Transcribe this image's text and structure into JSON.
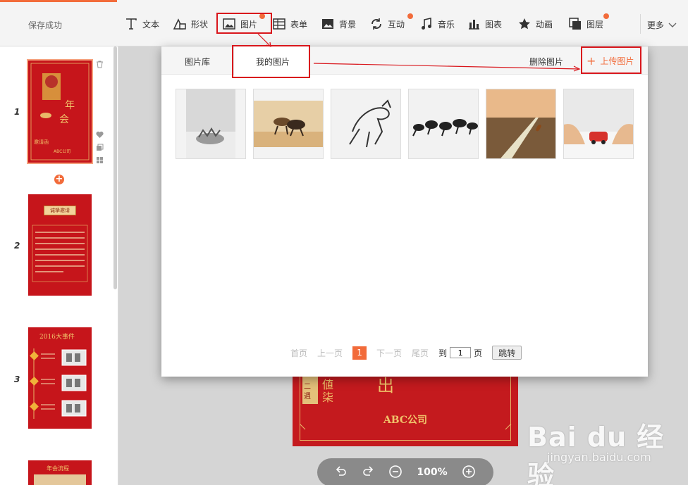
{
  "toolbar": {
    "status": "保存成功",
    "tools": [
      {
        "label": "文本",
        "icon": "text-icon"
      },
      {
        "label": "形状",
        "icon": "shape-icon"
      },
      {
        "label": "图片",
        "icon": "image-icon"
      },
      {
        "label": "表单",
        "icon": "form-icon"
      },
      {
        "label": "背景",
        "icon": "background-icon"
      },
      {
        "label": "互动",
        "icon": "interaction-icon"
      },
      {
        "label": "音乐",
        "icon": "music-icon"
      },
      {
        "label": "图表",
        "icon": "chart-icon"
      },
      {
        "label": "动画",
        "icon": "star-icon"
      },
      {
        "label": "图层",
        "icon": "layer-icon"
      }
    ],
    "more": "更多"
  },
  "sidebar": {
    "slides": [
      "1",
      "2",
      "3"
    ],
    "slide1_text": "ABC公司",
    "slide2_title": "诚挚邀请",
    "slide3_title": "2016大事件",
    "slide4_title": "年会流程"
  },
  "modal": {
    "tab_library": "图片库",
    "tab_mine": "我的图片",
    "delete": "删除图片",
    "upload": "上传图片",
    "images": [
      "white-horses-photo",
      "horses-desert-photo",
      "horse-sketch-photo",
      "horses-ink-photo",
      "road-sunset-photo",
      "hands-car-photo"
    ],
    "pager": {
      "first": "首页",
      "prev": "上一页",
      "current": "1",
      "next": "下一页",
      "last": "尾页",
      "to": "到",
      "page_value": "1",
      "page_unit": "页",
      "jump": "跳转"
    }
  },
  "canvas": {
    "company": "ABC公司",
    "zoom": "100%"
  },
  "watermark": {
    "brand": "Bai du 经验",
    "url": "jingyan.baidu.com"
  },
  "colors": {
    "accent": "#f26b3a",
    "slide_red": "#c6151b",
    "highlight": "#d9161c"
  }
}
